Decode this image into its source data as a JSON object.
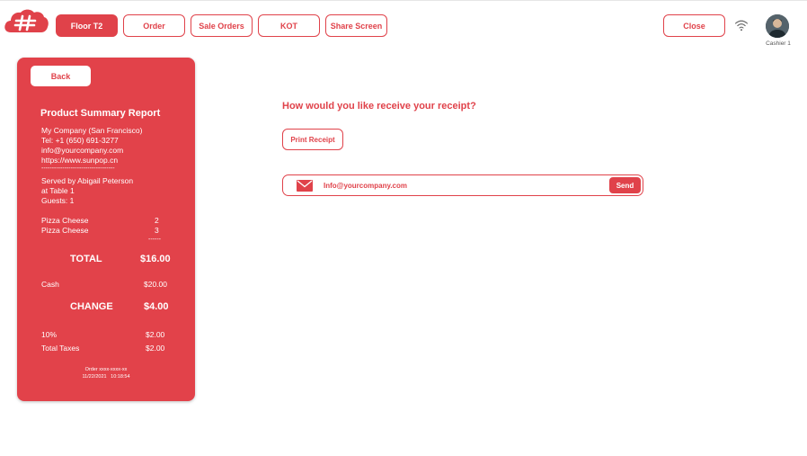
{
  "colors": {
    "accent": "#e0424a",
    "background": "#ffffff",
    "text_on_accent": "#ffffff"
  },
  "header": {
    "logo_icon": "cloud-hashtag-logo",
    "tabs": [
      {
        "label": "Floor T2",
        "active": true
      },
      {
        "label": "Order",
        "active": false
      },
      {
        "label": "Sale Orders",
        "active": false
      },
      {
        "label": "KOT",
        "active": false
      },
      {
        "label": "Share Screen",
        "active": false
      }
    ],
    "close_label": "Close",
    "wifi_icon": "wifi-icon",
    "user": {
      "name": "Cashier 1",
      "avatar_icon": "avatar"
    }
  },
  "receipt": {
    "back_label": "Back",
    "title": "Product Summary Report",
    "company": "My Company (San Francisco)",
    "tel": "Tel: +1 (650) 691-3277",
    "email": "info@yourcompany.com",
    "website": "https://www.sunpop.cn",
    "divider": "-----------------------------------",
    "served_by": "Served by Abigail Peterson",
    "table": "at Table 1",
    "guests": "Guests: 1",
    "items": [
      {
        "name": "Pizza Cheese",
        "qty": "2"
      },
      {
        "name": "Pizza Cheese",
        "qty": "3"
      }
    ],
    "qty_divider": "------",
    "total_label": "TOTAL",
    "total_value": "$16.00",
    "payment_label": "Cash",
    "payment_value": "$20.00",
    "change_label": "CHANGE",
    "change_value": "$4.00",
    "tax_rate_label": "10%",
    "tax_rate_value": "$2.00",
    "total_taxes_label": "Total Taxes",
    "total_taxes_value": "$2.00",
    "order_ref": "Order xxxx-xxxx-xx",
    "datetime": "11/22/2021   10:18:54"
  },
  "main": {
    "question": "How would you like receive your receipt?",
    "print_label": "Print Receipt",
    "email_value": "Info@yourcompany.com",
    "mail_icon": "mail-icon",
    "send_label": "Send"
  }
}
